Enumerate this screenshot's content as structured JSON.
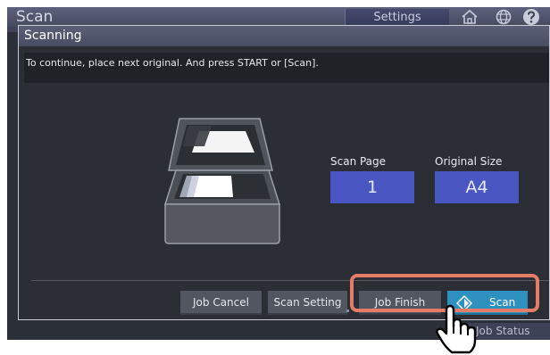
{
  "header": {
    "title": "Scan",
    "settings_label": "Settings",
    "icons": [
      "home-icon",
      "globe-icon",
      "help-icon"
    ]
  },
  "dialog": {
    "title": "Scanning",
    "message": "To continue, place next original. And press START or [Scan].",
    "scan_page": {
      "label": "Scan Page",
      "value": "1"
    },
    "original_size": {
      "label": "Original Size",
      "value": "A4"
    }
  },
  "buttons": {
    "job_cancel": "Job Cancel",
    "scan_setting": "Scan Setting",
    "job_finish": "Job Finish",
    "scan": "Scan"
  },
  "footer": {
    "job_status": "Job Status"
  },
  "colors": {
    "value_box": "#4a56c2",
    "scan_button": "#2f91bf",
    "highlight": "#e57c66"
  }
}
